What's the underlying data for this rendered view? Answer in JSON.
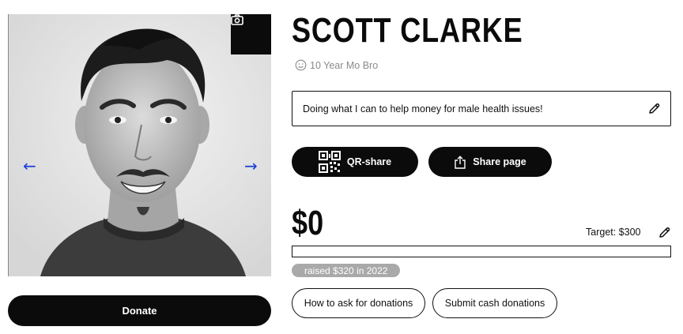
{
  "profile": {
    "name": "SCOTT CLARKE",
    "tenure": "10 Year Mo Bro",
    "description": "Doing what I can to help money for male health issues!"
  },
  "photo": {
    "prev_arrow": "←",
    "next_arrow": "→"
  },
  "actions": {
    "donate_label": "Donate",
    "qr_share_label": "QR-share",
    "share_page_label": "Share page",
    "ask_label": "How to ask for donations",
    "cash_label": "Submit cash donations"
  },
  "fundraising": {
    "amount_raised": "$0",
    "target_label": "Target: $300",
    "progress_fraction": 0,
    "history_badge": "raised $320 in 2022"
  },
  "icons": {
    "camera": "camera-icon",
    "edit": "pencil-icon",
    "qr": "qr-code-icon",
    "share": "share-icon",
    "tenure": "smiley-icon"
  },
  "colors": {
    "primary": "#0b0b0b",
    "arrow": "#1b3fd6",
    "badge": "#a9a9a9",
    "muted_text": "#8a8a8a"
  }
}
